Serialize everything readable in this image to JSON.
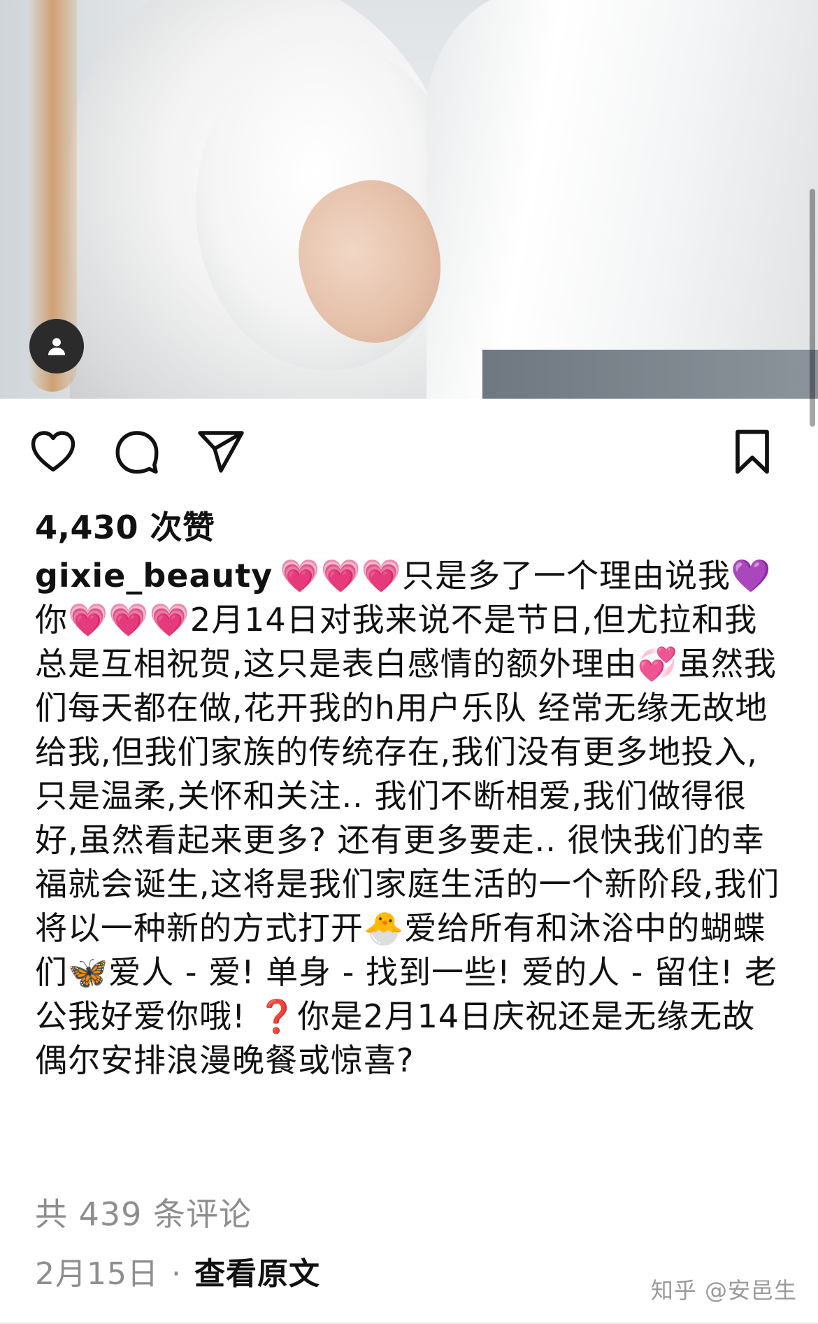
{
  "post": {
    "likes_label": "4,430 次赞",
    "username": "gixie_beauty",
    "caption": "💗💗💗只是多了一个理由说我💜你💗💗💗2月14日对我来说不是节日,但尤拉和我总是互相祝贺,这只是表白感情的额外理由💞虽然我们每天都在做,花开我的h用户乐队 经常无缘无故地给我,但我们家族的传统存在,我们没有更多地投入,只是温柔,关怀和关注.. 我们不断相爱,我们做得很好,虽然看起来更多? 还有更多要走.. 很快我们的幸福就会诞生,这将是我们家庭生活的一个新阶段,我们将以一种新的方式打开🐣爱给所有和沐浴中的蝴蝶们🦋爱人 - 爱! 单身 - 找到一些! 爱的人 - 留住! 老公我好爱你哦! ❓你是2月14日庆祝还是无缘无故偶尔安排浪漫晚餐或惊喜?",
    "comments_label": "共 439 条评论",
    "date": "2月15日",
    "separator": "·",
    "view_original": "查看原文"
  },
  "icons": {
    "avatar": "user-avatar-icon",
    "like": "heart-icon",
    "comment": "comment-bubble-icon",
    "share": "send-icon",
    "save": "bookmark-icon"
  },
  "watermark": "知乎 @安邑生"
}
